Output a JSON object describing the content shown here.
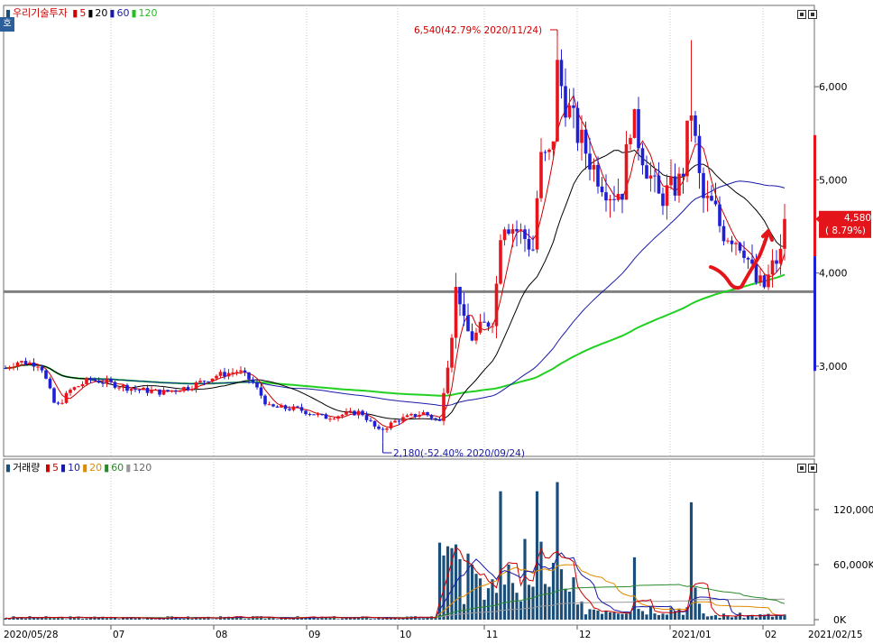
{
  "stock_panel": {
    "title": "우리기술투자",
    "badge": "호",
    "ma_legend": [
      {
        "label": "5",
        "color": "#cc0000"
      },
      {
        "label": "20",
        "color": "#000000"
      },
      {
        "label": "60",
        "color": "#1a1aa8"
      },
      {
        "label": "120",
        "color": "#22c022"
      }
    ],
    "price_axis_ticks": [
      "6,000",
      "5,000",
      "4,000",
      "3,000"
    ],
    "high_annotation": "6,540(42.79% 2020/11/24)",
    "low_annotation": "2,180(-52.40% 2020/09/24)",
    "last_price": "4,580",
    "last_change": "( 8.79%)"
  },
  "volume_panel": {
    "title": "거래량",
    "ma_legend": [
      {
        "label": "5",
        "color": "#cc0000"
      },
      {
        "label": "10",
        "color": "#1a1aa8"
      },
      {
        "label": "20",
        "color": "#e08a00"
      },
      {
        "label": "60",
        "color": "#2a8a2a"
      },
      {
        "label": "120",
        "color": "#999999"
      }
    ],
    "volume_axis_ticks": [
      "120,000K",
      "60,000K",
      "0K"
    ]
  },
  "date_axis": {
    "labels": [
      "2020/05/28",
      "07",
      "08",
      "09",
      "10",
      "11",
      "12",
      "2021/01",
      "02",
      "2021/02/15"
    ]
  },
  "colors": {
    "up": "#e8141b",
    "down": "#1f1fd6",
    "support_line": "#808080",
    "annotation": "#cc0000",
    "volume_bar": "#1b4f7a"
  },
  "chart_data": {
    "type": "candlestick",
    "title": "우리기술투자",
    "period": [
      "2020/05/28",
      "2021/02/15"
    ],
    "y_price_ticks": [
      3000,
      4000,
      5000,
      6000
    ],
    "y_volume_ticks_k": [
      0,
      60000,
      120000
    ],
    "series_close_approx": [
      {
        "date": "2020/05/28",
        "close": 2980
      },
      {
        "date": "2020/06",
        "close": 2700
      },
      {
        "date": "2020/07",
        "close": 2720
      },
      {
        "date": "2020/08",
        "close": 2780
      },
      {
        "date": "2020/09/24",
        "close": 2180
      },
      {
        "date": "2020/10/20",
        "close": 2400
      },
      {
        "date": "2020/10/23",
        "close": 3950
      },
      {
        "date": "2020/11/05",
        "close": 3600
      },
      {
        "date": "2020/11/24",
        "close": 6200
      },
      {
        "date": "2020/12",
        "close": 4800
      },
      {
        "date": "2021/01/12",
        "close": 5800
      },
      {
        "date": "2021/02/01",
        "close": 3850
      },
      {
        "date": "2021/02/15",
        "close": 4580
      }
    ],
    "high": {
      "value": 6540,
      "change_pct": 42.79,
      "date": "2020/11/24"
    },
    "low": {
      "value": 2180,
      "change_pct": -52.4,
      "date": "2020/09/24"
    },
    "last": {
      "value": 4580,
      "change_pct": 8.79
    },
    "support_level": 3800
  }
}
